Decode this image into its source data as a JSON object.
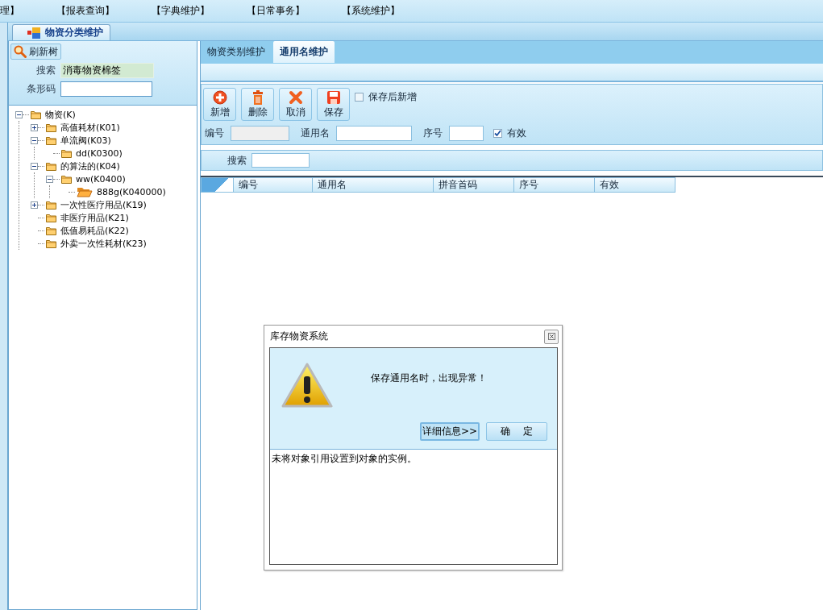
{
  "menu": [
    "理】",
    "【报表查询】",
    "【字典维护】",
    "【日常事务】",
    "【系统维护】"
  ],
  "document_tabs": [
    {
      "label": "物资分类维护",
      "selected": true
    }
  ],
  "left_panel": {
    "refresh_button": "刷新树",
    "search": {
      "label": "搜索",
      "value": "消毒物资棉签"
    },
    "barcode": {
      "label": "条形码"
    }
  },
  "tree": [
    {
      "label": "物资(K)",
      "expanded": true,
      "selected": false,
      "children": [
        {
          "label": "高值耗材(K01)",
          "expanded": false,
          "selected": false
        },
        {
          "label": "单流阀(K03)",
          "expanded": true,
          "selected": false,
          "children": [
            {
              "label": "dd(K0300)",
              "selected": false
            }
          ]
        },
        {
          "label": "的算法的(K04)",
          "expanded": true,
          "selected": false,
          "children": [
            {
              "label": "ww(K0400)",
              "expanded": true,
              "selected": false,
              "children": [
                {
                  "label": "888g(K040000)",
                  "selected": true
                }
              ]
            }
          ]
        },
        {
          "label": "一次性医疗用品(K19)",
          "expanded": false,
          "selected": false
        },
        {
          "label": "非医疗用品(K21)",
          "selected": false
        },
        {
          "label": "低值易耗品(K22)",
          "selected": false
        },
        {
          "label": "外卖一次性耗材(K23)",
          "selected": false
        }
      ]
    }
  ],
  "right_panel": {
    "tabs": [
      {
        "label": "物资类别维护",
        "selected": false
      },
      {
        "label": "通用名维护",
        "selected": true
      }
    ],
    "toolbar": [
      {
        "label": "新增"
      },
      {
        "label": "删除"
      },
      {
        "label": "取消"
      },
      {
        "label": "保存"
      }
    ],
    "save_and_new": {
      "label": "保存后新增",
      "checked": false
    },
    "form": [
      {
        "kind": "field",
        "label": "编号",
        "disabled": true
      },
      {
        "kind": "field",
        "label": "通用名",
        "disabled": false
      },
      {
        "kind": "field",
        "label": "序号",
        "disabled": false
      },
      {
        "kind": "checkbox",
        "label": "有效",
        "checked": true
      }
    ],
    "search": {
      "label": "搜索"
    },
    "grid": {
      "columns": [
        "编号",
        "通用名",
        "拼音首码",
        "序号",
        "有效"
      ]
    }
  },
  "dialog": {
    "title": "库存物资系统",
    "message": "保存通用名时，出现异常！",
    "buttons": [
      {
        "label": "详细信息>>",
        "selected": true
      },
      {
        "label": "确    定",
        "selected": false
      }
    ],
    "details": "未将对象引用设置到对象的实例。"
  }
}
